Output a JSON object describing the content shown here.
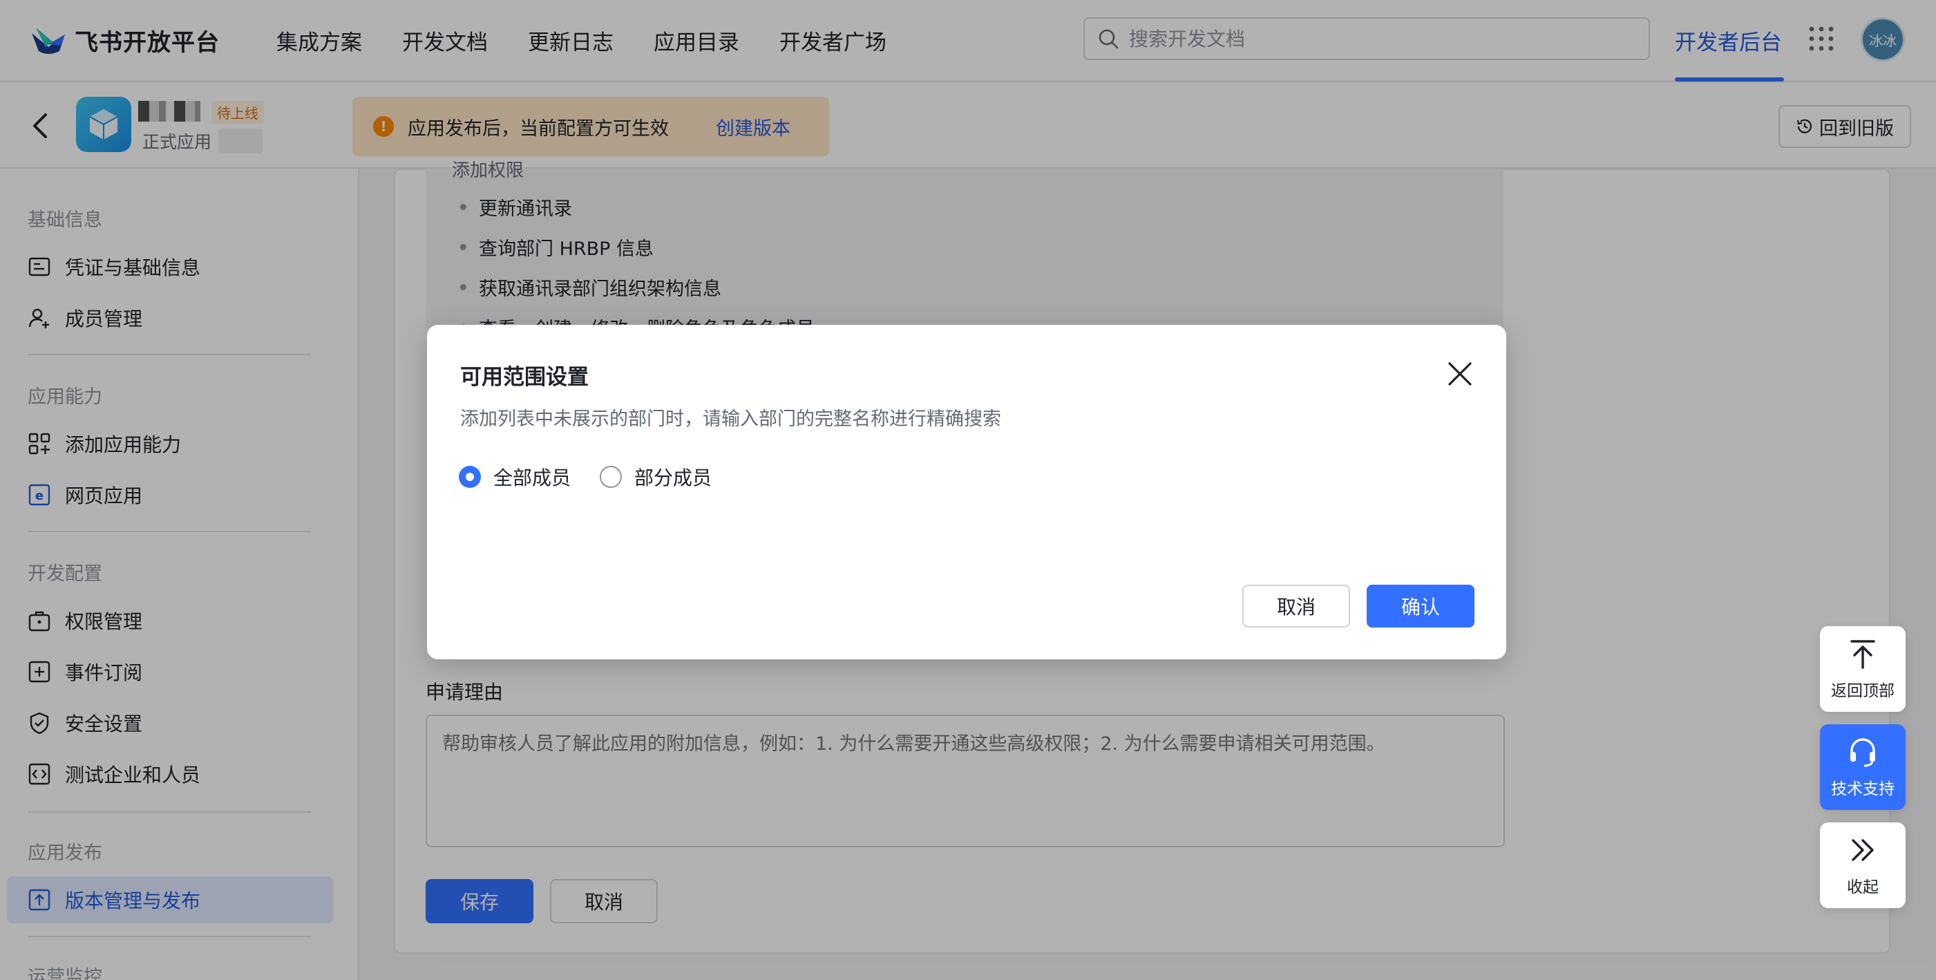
{
  "topnav": {
    "brand": "飞书开放平台",
    "links": [
      "集成方案",
      "开发文档",
      "更新日志",
      "应用目录",
      "开发者广场"
    ],
    "search_placeholder": "搜索开发文档",
    "dev_console": "开发者后台",
    "avatar_text": "冰冰"
  },
  "app_header": {
    "status_badge": "待上线",
    "app_type": "正式应用",
    "notice_text": "应用发布后，当前配置方可生效",
    "notice_link": "创建版本",
    "back_to_old": "回到旧版"
  },
  "sidebar": {
    "groups": [
      {
        "title": "基础信息",
        "items": [
          {
            "label": "凭证与基础信息",
            "icon": "id-card-icon"
          },
          {
            "label": "成员管理",
            "icon": "user-plus-icon"
          }
        ]
      },
      {
        "title": "应用能力",
        "items": [
          {
            "label": "添加应用能力",
            "icon": "grid-add-icon"
          },
          {
            "label": "网页应用",
            "icon": "web-app-icon"
          }
        ]
      },
      {
        "title": "开发配置",
        "items": [
          {
            "label": "权限管理",
            "icon": "briefcase-icon"
          },
          {
            "label": "事件订阅",
            "icon": "plus-box-icon"
          },
          {
            "label": "安全设置",
            "icon": "shield-icon"
          },
          {
            "label": "测试企业和人员",
            "icon": "code-box-icon"
          }
        ]
      },
      {
        "title": "应用发布",
        "items": [
          {
            "label": "版本管理与发布",
            "icon": "upload-box-icon",
            "active": true
          }
        ]
      },
      {
        "title": "运营监控",
        "items": []
      }
    ]
  },
  "content": {
    "perm_title": "添加权限",
    "permissions": [
      "更新通讯录",
      "查询部门 HRBP 信息",
      "获取通讯录部门组织架构信息",
      "查看、创建、修改、删除角色及角色成员"
    ],
    "reason_label": "申请理由",
    "reason_placeholder": "帮助审核人员了解此应用的附加信息，例如：1. 为什么需要开通这些高级权限；2. 为什么需要申请相关可用范围。",
    "save": "保存",
    "cancel": "取消"
  },
  "modal": {
    "title": "可用范围设置",
    "desc": "添加列表中未展示的部门时，请输入部门的完整名称进行精确搜索",
    "options": [
      {
        "label": "全部成员",
        "checked": true
      },
      {
        "label": "部分成员",
        "checked": false
      }
    ],
    "cancel": "取消",
    "confirm": "确认"
  },
  "float_widgets": {
    "back_top": "返回顶部",
    "support": "技术支持",
    "collapse": "收起"
  },
  "colors": {
    "accent": "#3370ff",
    "warning": "#ff8800",
    "notice_bg": "#ffe4c4"
  }
}
